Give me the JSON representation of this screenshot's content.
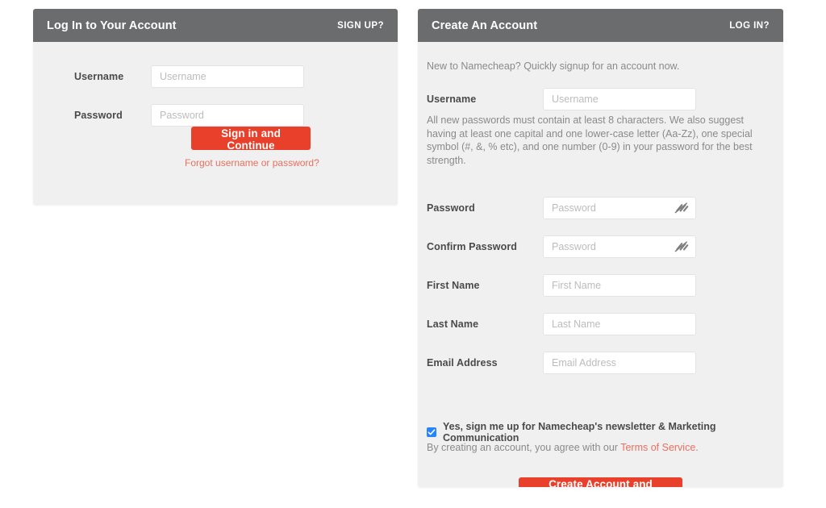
{
  "theme": {
    "header_gray": "#6b6c6e",
    "panel_bg": "#f0f0f0",
    "accent_red": "#e8402a",
    "link_red": "#e8705f",
    "checkbox_blue": "#2684ff",
    "label_text": "#4a4a4a",
    "muted_text": "#8a8a8a",
    "placeholder_text": "#bcbcbc"
  },
  "login_panel": {
    "title": "Log In to Your Account",
    "header_link": "SIGN UP?",
    "username": {
      "label": "Username",
      "placeholder": "Username",
      "value": ""
    },
    "password": {
      "label": "Password",
      "placeholder": "Password",
      "value": ""
    },
    "submit_label": "Sign in and Continue",
    "forgot_link": "Forgot username or password?"
  },
  "signup_panel": {
    "title": "Create An Account",
    "header_link": "LOG IN?",
    "intro": "New to Namecheap? Quickly signup for an account now.",
    "username": {
      "label": "Username",
      "placeholder": "Username",
      "value": ""
    },
    "password_note": "All new passwords must contain at least 8 characters. We also suggest having at least one capital and one lower-case letter (Aa-Zz), one special symbol (#, &, % etc), and one number (0-9) in your password for the best strength.",
    "password": {
      "label": "Password",
      "placeholder": "Password",
      "value": "",
      "toggle_icon": "eye-slash-icon"
    },
    "confirm_password": {
      "label": "Confirm Password",
      "placeholder": "Password",
      "value": "",
      "toggle_icon": "eye-slash-icon"
    },
    "first_name": {
      "label": "First Name",
      "placeholder": "First Name",
      "value": ""
    },
    "last_name": {
      "label": "Last Name",
      "placeholder": "Last Name",
      "value": ""
    },
    "email": {
      "label": "Email Address",
      "placeholder": "Email Address",
      "value": ""
    },
    "newsletter": {
      "checked": true,
      "label": "Yes, sign me up for Namecheap's newsletter & Marketing Communication"
    },
    "terms": {
      "prefix": "By creating an account, you agree with our ",
      "link": "Terms of Service",
      "suffix": "."
    },
    "submit_label": "Create Account and Continue"
  }
}
